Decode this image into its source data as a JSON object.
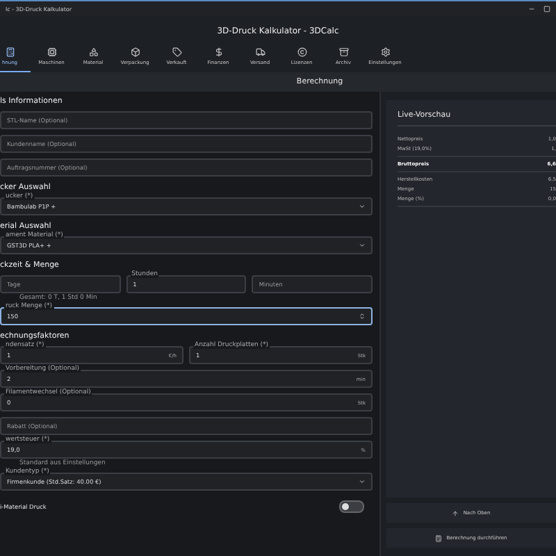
{
  "window": {
    "title": "lc - 3D-Druck Kalkulator"
  },
  "app_title": "3D-Druck Kalkulator - 3DCalc",
  "tabs": [
    {
      "label": "hnung",
      "selected": true
    },
    {
      "label": "Maschinen",
      "selected": false
    },
    {
      "label": "Material",
      "selected": false
    },
    {
      "label": "Verpackung",
      "selected": false
    },
    {
      "label": "Verkauft",
      "selected": false
    },
    {
      "label": "Finanzen",
      "selected": false
    },
    {
      "label": "Versand",
      "selected": false
    },
    {
      "label": "Lizenzen",
      "selected": false
    },
    {
      "label": "Archiv",
      "selected": false
    },
    {
      "label": "Einstellungen",
      "selected": false
    }
  ],
  "page_header": "Berechnung",
  "sections": [
    {
      "heading": "ls Informationen",
      "items": [
        {
          "kind": "field",
          "placeholder": "STL-Name (Optional)"
        },
        {
          "kind": "field",
          "placeholder": "Kundenname (Optional)"
        },
        {
          "kind": "field",
          "placeholder": "Auftragsnummer (Optional)"
        }
      ]
    },
    {
      "heading": "cker Auswahl",
      "items": [
        {
          "kind": "select",
          "label": "ucker (*)",
          "value": "Bambulab P1P +"
        }
      ]
    },
    {
      "heading": "erial Auswahl",
      "items": [
        {
          "kind": "select",
          "label": "ament Material (*)",
          "value": "GST3D PLA+ +"
        }
      ]
    },
    {
      "heading": "ckzeit & Menge",
      "items": [
        {
          "kind": "row",
          "fields": [
            {
              "placeholder": "Tage"
            },
            {
              "label": "Stunden",
              "value": "1"
            },
            {
              "placeholder": "Minuten"
            }
          ]
        },
        {
          "kind": "hint",
          "text": "Gesamt: 0 T, 1 Std 0 Min"
        },
        {
          "kind": "field",
          "label": "ruck Menge (*)",
          "value": "150",
          "focused": true,
          "stepper": true
        }
      ]
    },
    {
      "heading": "echnungsfaktoren",
      "items": [
        {
          "kind": "row",
          "fields": [
            {
              "label": "ndensatz (*)",
              "value": "1",
              "unit": "€/h"
            },
            {
              "label": "Anzahl Druckplatten (*)",
              "value": "1",
              "unit": "Stk"
            }
          ]
        },
        {
          "kind": "field",
          "label": "Vorbereitung (Optional)",
          "value": "2",
          "unit": "min"
        },
        {
          "kind": "field",
          "label": "Filamentwechsel (Optional)",
          "value": "0",
          "unit": "Stk"
        },
        {
          "kind": "field",
          "placeholder": "Rabatt (Optional)"
        },
        {
          "kind": "field",
          "label": "wertsteuer (*)",
          "value": "19,0",
          "unit": "%"
        },
        {
          "kind": "hint",
          "text": "Standard aus Einstellungen"
        },
        {
          "kind": "select",
          "label": "Kundentyp (*)",
          "value": "Firmenkunde (Std.Satz: 40.00 €)"
        },
        {
          "kind": "toggle",
          "label": "i-Material Druck",
          "on": false
        }
      ]
    }
  ],
  "preview": {
    "title": "Live-Vorschau",
    "groups": [
      [
        {
          "label": "Nettopreis",
          "value": "1,0",
          "bold": false
        },
        {
          "label": "MwSt (19,0%)",
          "value": "1,",
          "bold": false
        }
      ],
      [
        {
          "label": "Bruttopreis",
          "value": "6,6",
          "bold": true
        }
      ],
      [
        {
          "label": "Herstellkosten",
          "value": "6,5",
          "bold": false
        },
        {
          "label": "Menge",
          "value": "15",
          "bold": false
        },
        {
          "label": "Menge (%)",
          "value": "0,0",
          "bold": false
        }
      ]
    ]
  },
  "buttons": [
    {
      "label": "Nach Oben"
    },
    {
      "label": "Berechnung durchführen"
    }
  ]
}
